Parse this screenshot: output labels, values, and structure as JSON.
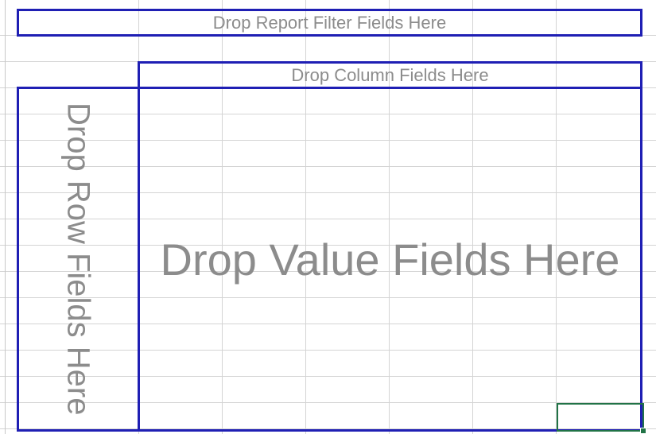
{
  "pivot_table": {
    "report_filter_label": "Drop Report Filter Fields Here",
    "column_label": "Drop Column Fields Here",
    "row_label": "Drop Row Fields Here",
    "value_label": "Drop Value Fields Here"
  },
  "colors": {
    "drop_zone_border": "#1f1fb4",
    "placeholder_text": "#8c8c8c",
    "selected_cell_border": "#217346",
    "gridline": "#d4d4d4"
  }
}
